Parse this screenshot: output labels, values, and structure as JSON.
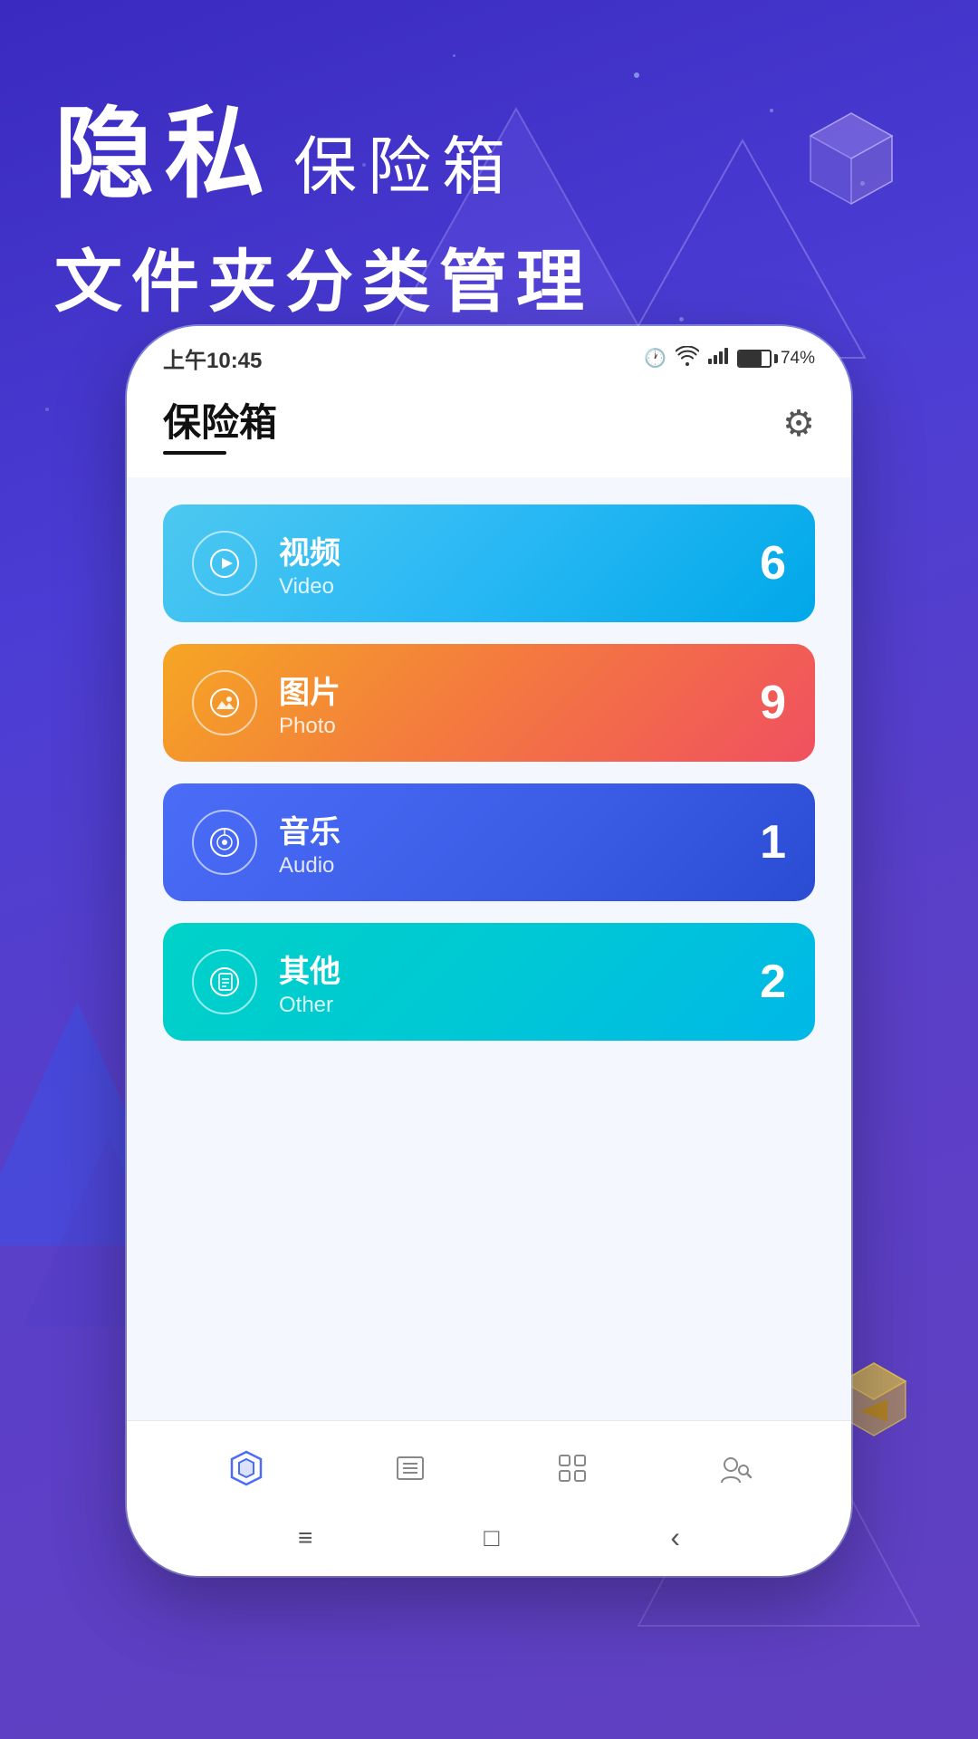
{
  "background": {
    "gradient_start": "#3a2abf",
    "gradient_end": "#6040c0"
  },
  "header": {
    "line1_large": "隐私",
    "line1_small": "保险箱",
    "line2": "文件夹分类管理"
  },
  "phone": {
    "status_bar": {
      "time": "上午10:45",
      "battery_percent": "74%"
    },
    "app_title": "保险箱",
    "settings_icon": "⚙",
    "categories": [
      {
        "id": "video",
        "label_cn": "视频",
        "label_en": "Video",
        "count": "6",
        "icon": "▶"
      },
      {
        "id": "photo",
        "label_cn": "图片",
        "label_en": "Photo",
        "count": "9",
        "icon": "⛰"
      },
      {
        "id": "audio",
        "label_cn": "音乐",
        "label_en": "Audio",
        "count": "1",
        "icon": "♪"
      },
      {
        "id": "other",
        "label_cn": "其他",
        "label_en": "Other",
        "count": "2",
        "icon": "📄"
      }
    ],
    "bottom_nav": [
      {
        "id": "vault",
        "icon": "🛡",
        "active": true
      },
      {
        "id": "list",
        "icon": "≡",
        "active": false
      },
      {
        "id": "apps",
        "icon": "⠿",
        "active": false
      },
      {
        "id": "user",
        "icon": "👥",
        "active": false
      }
    ],
    "system_nav": {
      "menu": "≡",
      "home": "□",
      "back": "‹"
    }
  }
}
